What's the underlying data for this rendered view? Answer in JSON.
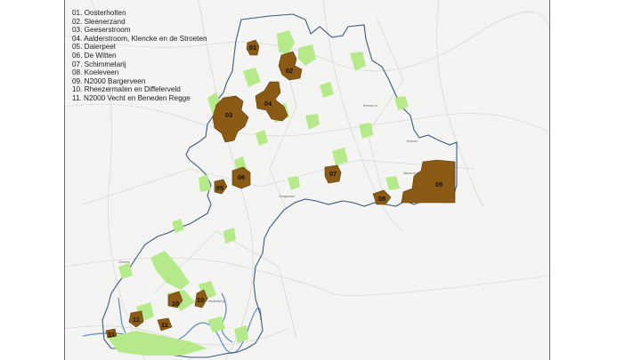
{
  "legend": [
    "01. Oosterholten",
    "02. Sleenerzand",
    "03. Geeserstroom",
    "04. Aalderstroom, Klencke en de Stroeten",
    "05. Dalerpeel",
    "06. De Witten",
    "07. Schimmelarij",
    "08. Koeleveen",
    "09. N2000 Bargerveen",
    "10. Rheezermaten en Diffelerveld",
    "11. N2000 Vecht en Beneden Regge"
  ],
  "area_labels": [
    "01",
    "02",
    "03",
    "04",
    "05",
    "06",
    "07",
    "08",
    "09",
    "10",
    "10",
    "11",
    "11",
    "11"
  ],
  "colors": {
    "area_fill": "#8b5a14",
    "area_stroke": "#5c3a0a",
    "nature_green": "#b5e98a",
    "boundary": "#3d5a7a",
    "water": "#6a8fc4",
    "road": "#d6d6d6",
    "background": "#f4f4f2"
  }
}
